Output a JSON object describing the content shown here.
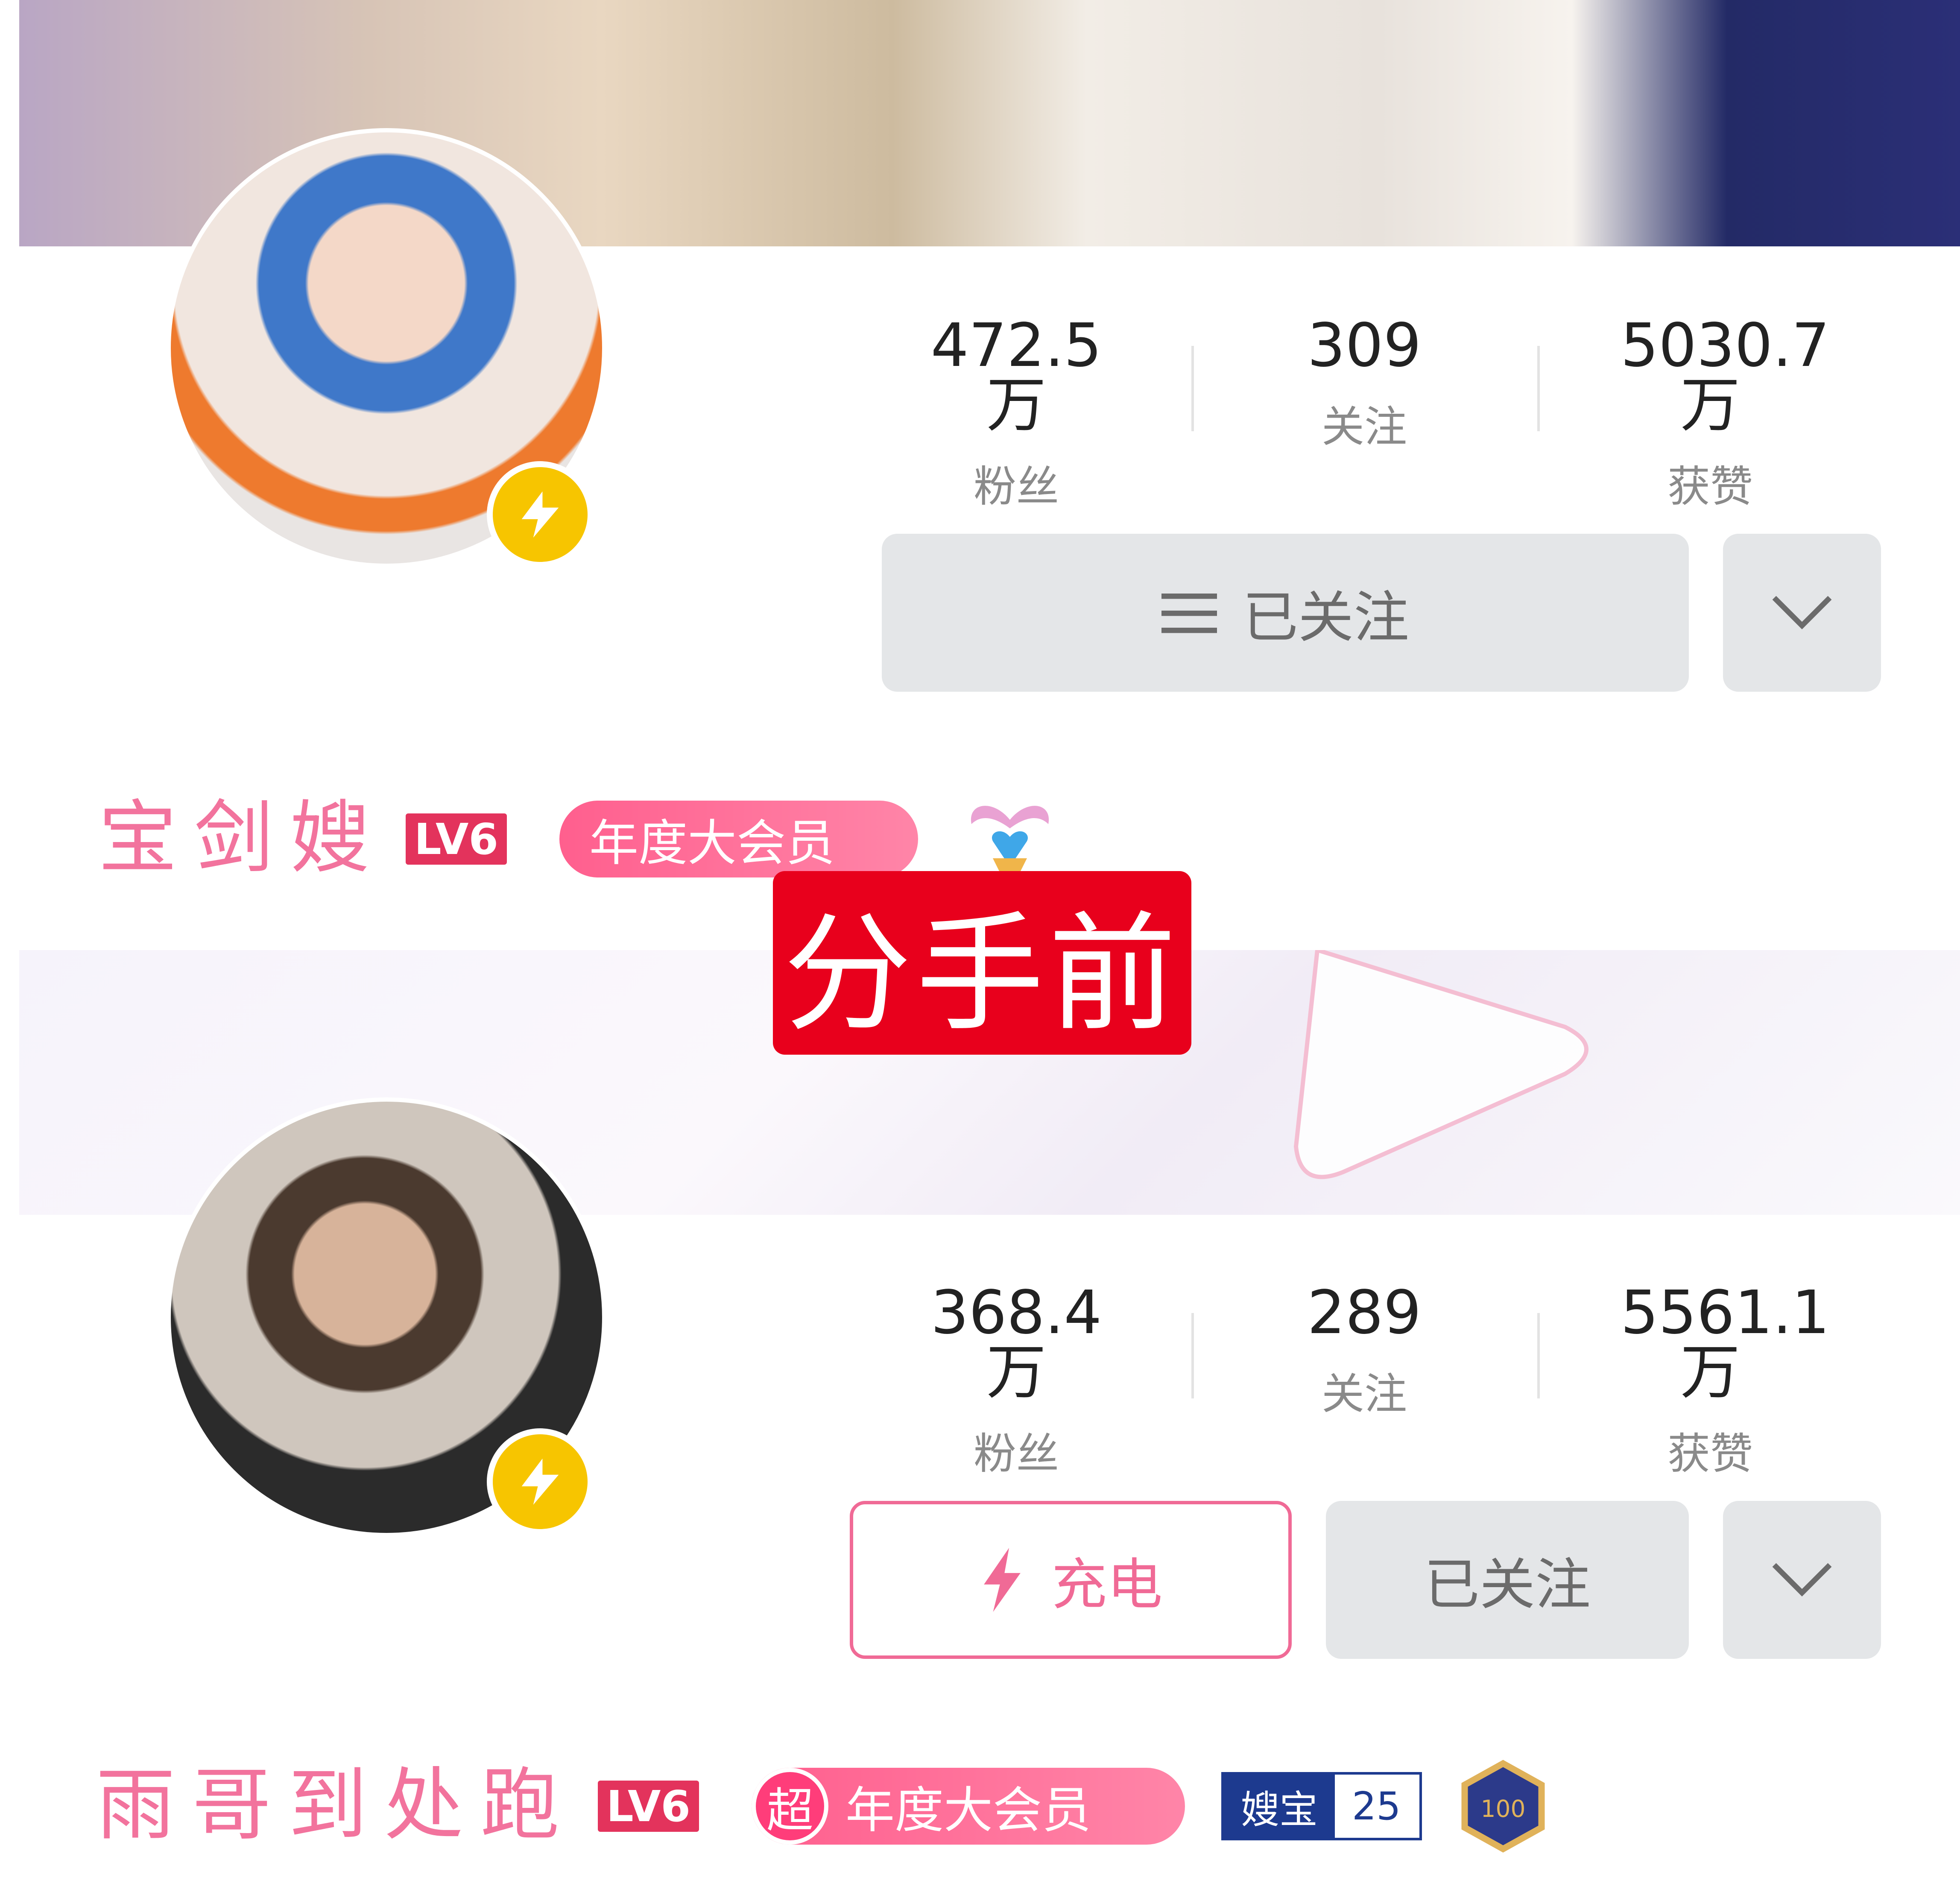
{
  "top": {
    "stats": [
      {
        "value": "472.5万",
        "label": "粉丝"
      },
      {
        "value": "309",
        "label": "关注"
      },
      {
        "value": "5030.7万",
        "label": "获赞"
      }
    ],
    "follow_label": "已关注",
    "username": "宝剑嫂",
    "level": "LV6",
    "vip_label": "年度大会员"
  },
  "overlay_label": "分手前",
  "bottom": {
    "stats": [
      {
        "value": "368.4万",
        "label": "粉丝"
      },
      {
        "value": "289",
        "label": "关注"
      },
      {
        "value": "5561.1万",
        "label": "获赞"
      }
    ],
    "charge_label": "充电",
    "follow_label": "已关注",
    "username": "雨哥到处跑",
    "level": "LV6",
    "vip_super": "超",
    "vip_label": "年度大会员",
    "fan_badge_name": "嫂宝",
    "fan_badge_level": "25",
    "medal_text": "100"
  },
  "colors": {
    "accent_pink": "#f2739d",
    "badge_yellow": "#f7c500",
    "overlay_red": "#e8001c"
  },
  "icons": [
    "bolt-icon",
    "menu-icon",
    "chevron-down-icon",
    "wings-heart-icon",
    "medal-100-icon"
  ]
}
